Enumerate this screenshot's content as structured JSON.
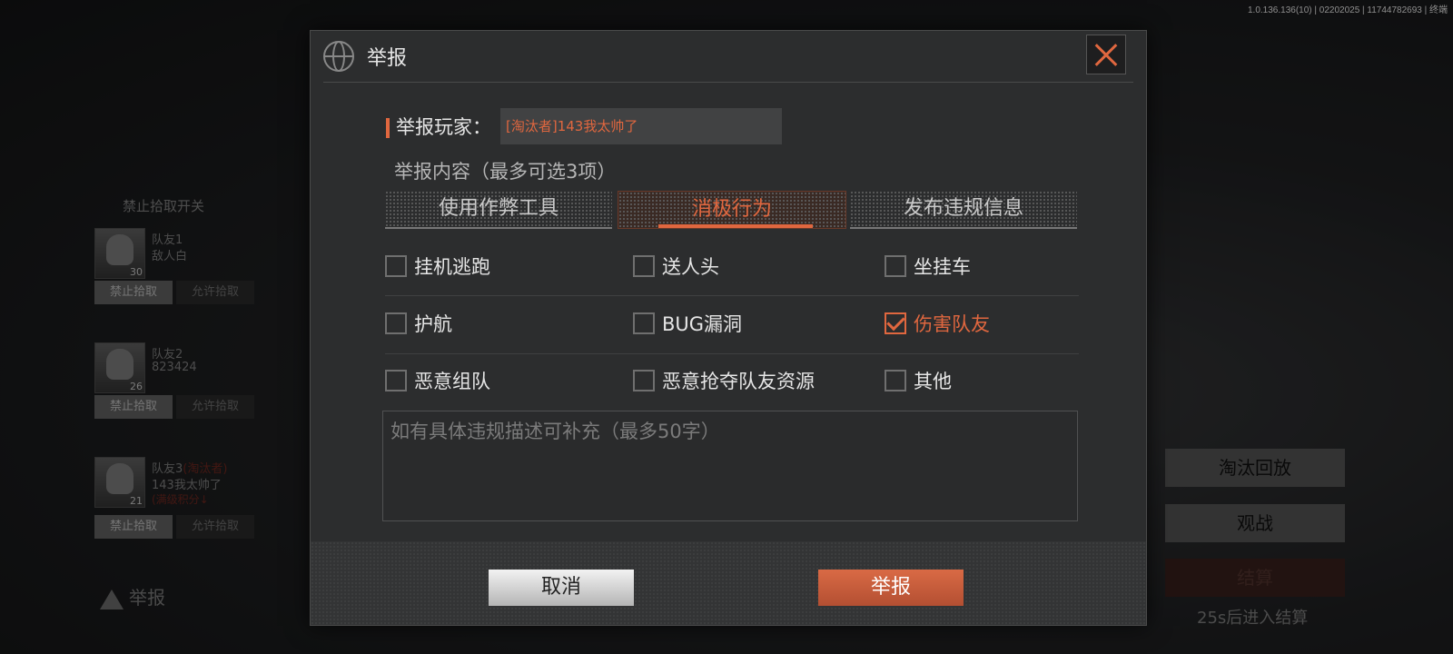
{
  "version": "1.0.136.136(10) | 02202025 | 11744782693 | 终端",
  "team_panel": {
    "title": "禁止拾取开关",
    "mates": [
      {
        "name": "队友1",
        "sub": "敌人白",
        "level": "30",
        "ban_label": "禁止拾取",
        "allow_label": "允许拾取"
      },
      {
        "name": "队友2",
        "sub": "823424",
        "level": "26",
        "ban_label": "禁止拾取",
        "allow_label": "允许拾取"
      },
      {
        "name": "队友3",
        "tag": "(淘汰者)",
        "sub": "143我太帅了",
        "sub2": "(满级积分↓",
        "level": "21",
        "ban_label": "禁止拾取",
        "allow_label": "允许拾取"
      }
    ],
    "report_label": "举报"
  },
  "right_panel": {
    "replay_label": "淘汰回放",
    "spectate_label": "观战",
    "settle_label": "结算",
    "countdown": "25s后进入结算"
  },
  "modal": {
    "title": "举报",
    "player_label": "举报玩家：",
    "player_value": "[淘汰者]143我太帅了",
    "content_label": "举报内容（最多可选3项）",
    "tabs": [
      {
        "label": "使用作弊工具",
        "active": false
      },
      {
        "label": "消极行为",
        "active": true
      },
      {
        "label": "发布违规信息",
        "active": false
      }
    ],
    "options": [
      {
        "label": "挂机逃跑",
        "checked": false
      },
      {
        "label": "送人头",
        "checked": false
      },
      {
        "label": "坐挂车",
        "checked": false
      },
      {
        "label": "护航",
        "checked": false
      },
      {
        "label": "BUG漏洞",
        "checked": false
      },
      {
        "label": "伤害队友",
        "checked": true
      },
      {
        "label": "恶意组队",
        "checked": false
      },
      {
        "label": "恶意抢夺队友资源",
        "checked": false
      },
      {
        "label": "其他",
        "checked": false
      }
    ],
    "textarea_placeholder": "如有具体违规描述可补充（最多50字）",
    "cancel_label": "取消",
    "submit_label": "举报"
  },
  "colors": {
    "accent": "#e0673f",
    "panel": "#2c2d2e"
  }
}
